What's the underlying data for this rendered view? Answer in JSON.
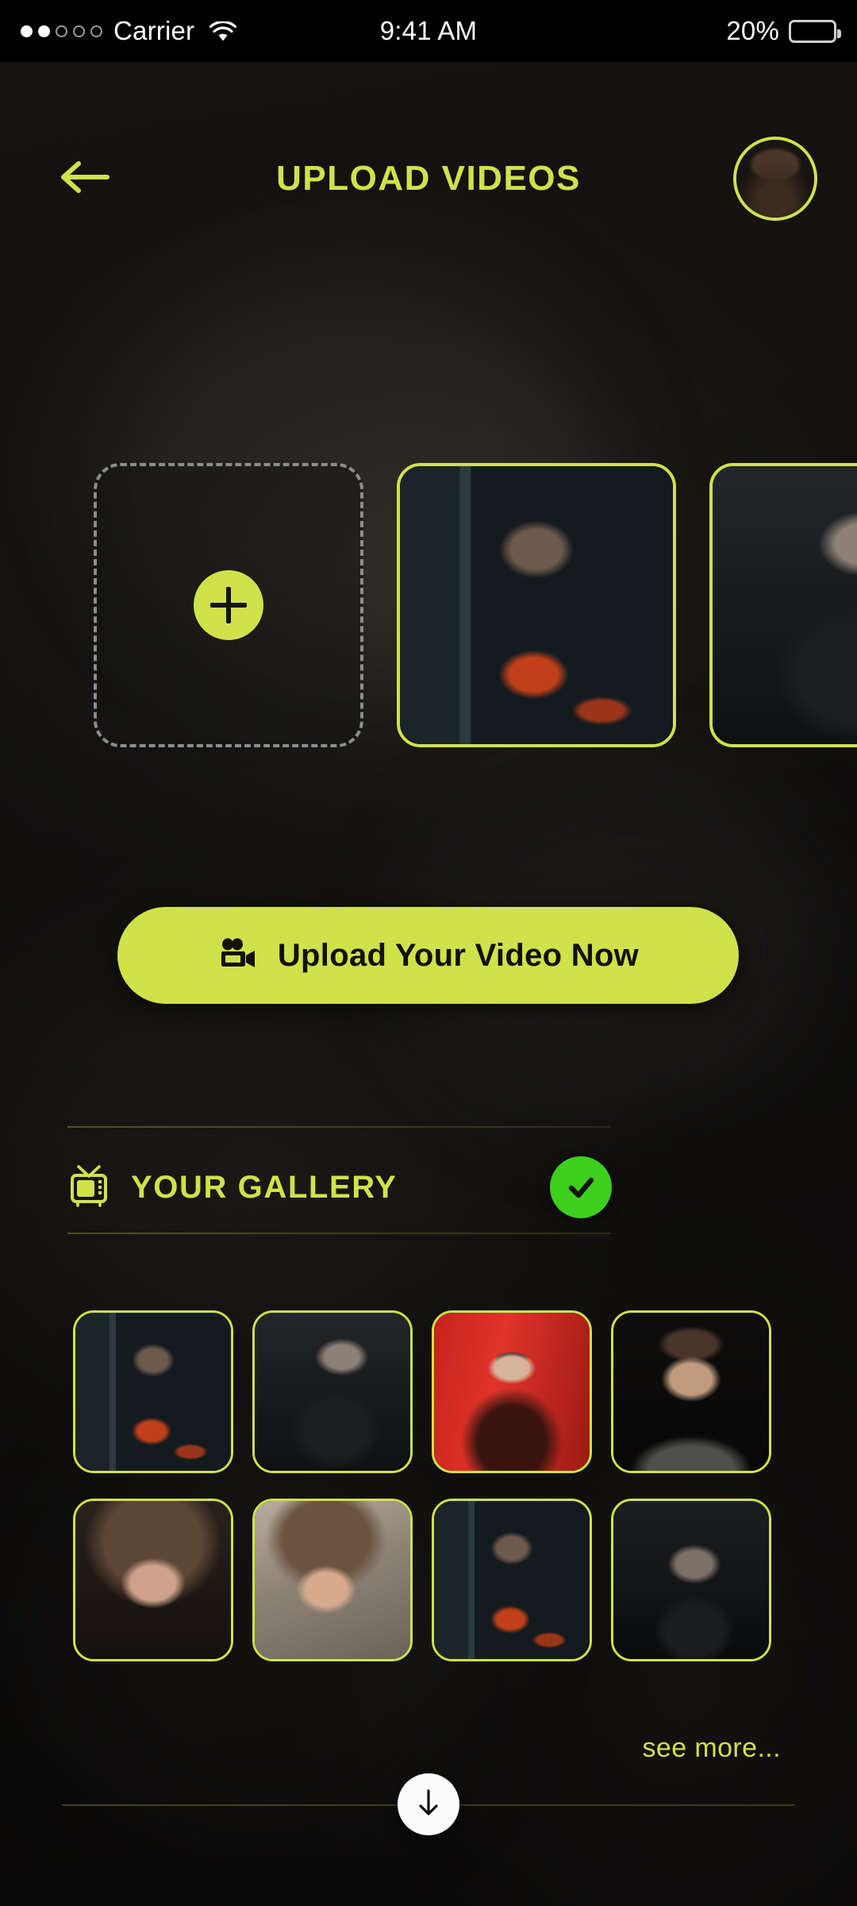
{
  "status_bar": {
    "carrier": "Carrier",
    "signal_dots_filled": 2,
    "signal_dots_total": 5,
    "wifi_icon": "wifi-icon",
    "time": "9:41 AM",
    "battery_percent": "20%",
    "battery_level": 20
  },
  "header": {
    "back_icon": "arrow-left-icon",
    "title": "UPLOAD VIDEOS",
    "avatar_alt": "user-avatar"
  },
  "colors": {
    "accent": "#cfe249",
    "background": "#121110",
    "check_green": "#3ecf1e",
    "dashed_border": "#8d8d8d",
    "button_text": "#111108"
  },
  "carousel": {
    "add_card": {
      "icon": "plus-icon",
      "label": ""
    },
    "items": [
      {
        "name": "video-thumb-superman",
        "style": "ph-superman"
      },
      {
        "name": "video-thumb-glasses-man",
        "style": "ph-glasses-man"
      }
    ]
  },
  "upload_button": {
    "icon": "video-camera-icon",
    "label": "Upload Your Video Now"
  },
  "gallery": {
    "icon": "tv-icon",
    "title": "YOUR GALLERY",
    "status_icon": "check-circle-icon",
    "rows": [
      [
        {
          "name": "gallery-thumb-1",
          "style": "ph-superman"
        },
        {
          "name": "gallery-thumb-2",
          "style": "ph-glasses-man"
        },
        {
          "name": "gallery-thumb-3",
          "style": "ph-red-woman"
        },
        {
          "name": "gallery-thumb-4",
          "style": "ph-beard-man"
        }
      ],
      [
        {
          "name": "gallery-thumb-5",
          "style": "ph-yellow-glasses"
        },
        {
          "name": "gallery-thumb-6",
          "style": "ph-wall-woman"
        },
        {
          "name": "gallery-thumb-7",
          "style": "ph-superman"
        },
        {
          "name": "gallery-thumb-8",
          "style": "ph-dark-man"
        }
      ]
    ]
  },
  "footer": {
    "see_more_label": "see more...",
    "scroll_icon": "arrow-down-icon"
  }
}
